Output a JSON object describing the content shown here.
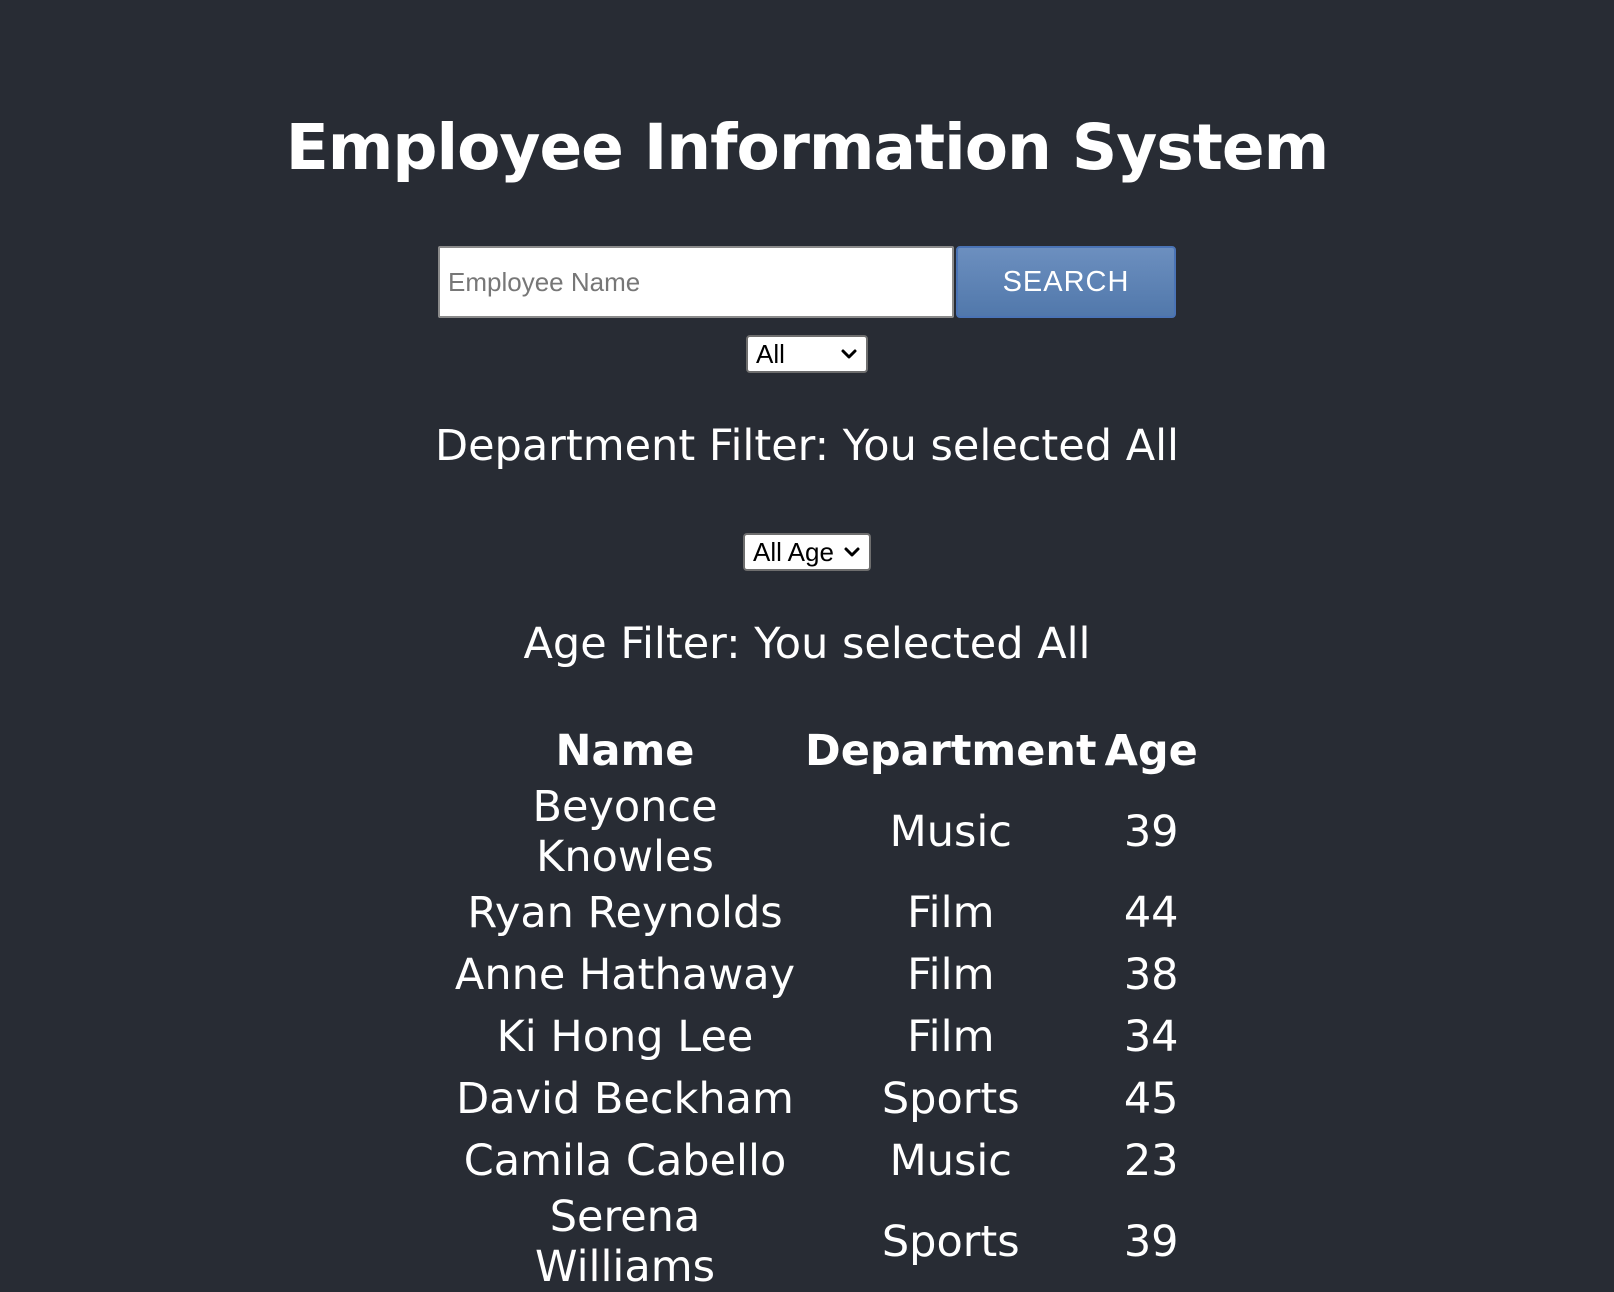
{
  "header": {
    "title": "Employee Information System"
  },
  "search": {
    "placeholder": "Employee Name",
    "value": "",
    "button_label": "SEARCH"
  },
  "department_filter": {
    "selected": "All",
    "status_text": "Department Filter: You selected All"
  },
  "age_filter": {
    "selected": "All Age",
    "status_text": "Age Filter: You selected All"
  },
  "table": {
    "headers": [
      "Name",
      "Department",
      "Age"
    ],
    "rows": [
      [
        "Beyonce Knowles",
        "Music",
        "39"
      ],
      [
        "Ryan Reynolds",
        "Film",
        "44"
      ],
      [
        "Anne Hathaway",
        "Film",
        "38"
      ],
      [
        "Ki Hong Lee",
        "Film",
        "34"
      ],
      [
        "David Beckham",
        "Sports",
        "45"
      ],
      [
        "Camila Cabello",
        "Music",
        "23"
      ],
      [
        "Serena Williams",
        "Sports",
        "39"
      ]
    ]
  },
  "colors": {
    "background": "#282c34",
    "button": "#5b80b2",
    "text": "#ffffff"
  }
}
